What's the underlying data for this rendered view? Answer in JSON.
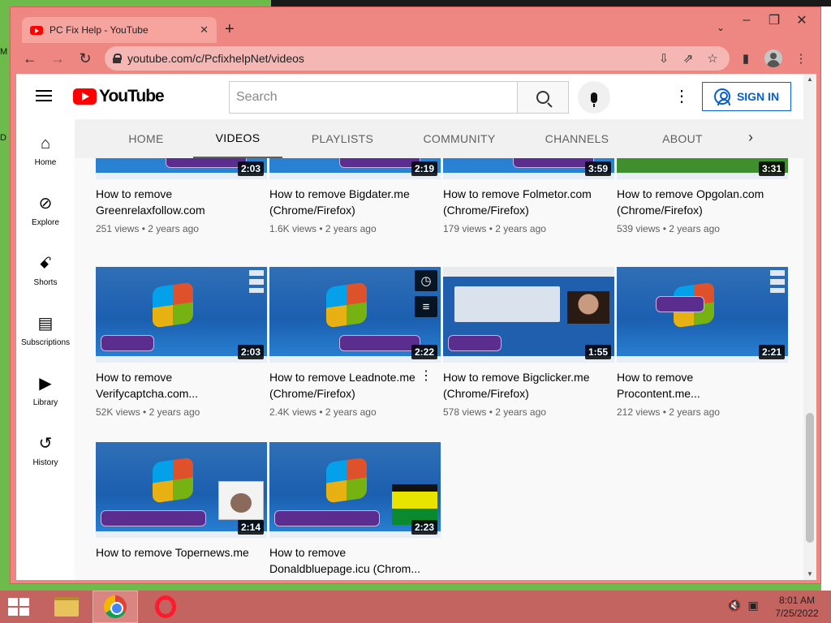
{
  "desktop": {
    "edge_letters": [
      "M",
      "D"
    ]
  },
  "browser": {
    "tab_title": "PC Fix Help - YouTube",
    "url": "youtube.com/c/PcfixhelpNet/videos",
    "window_controls": [
      "–",
      "❐",
      "✕"
    ]
  },
  "youtube": {
    "logo_text": "YouTube",
    "search_placeholder": "Search",
    "sign_in_label": "SIGN IN",
    "sidebar": [
      {
        "label": "Home",
        "icon": "home-icon",
        "glyph": "⌂"
      },
      {
        "label": "Explore",
        "icon": "compass-icon",
        "glyph": "⊘"
      },
      {
        "label": "Shorts",
        "icon": "shorts-icon",
        "glyph": "ꗃ"
      },
      {
        "label": "Subscriptions",
        "icon": "subscriptions-icon",
        "glyph": "▤"
      },
      {
        "label": "Library",
        "icon": "library-icon",
        "glyph": "▶"
      },
      {
        "label": "History",
        "icon": "history-icon",
        "glyph": "↺"
      }
    ],
    "channel_tabs": [
      "HOME",
      "VIDEOS",
      "PLAYLISTS",
      "COMMUNITY",
      "CHANNELS",
      "ABOUT"
    ],
    "active_tab": "VIDEOS",
    "videos": [
      {
        "title": "How to remove Greenrelaxfollow.com",
        "views": "251 views",
        "age": "2 years ago",
        "duration": "2:03"
      },
      {
        "title": "How to remove Bigdater.me (Chrome/Firefox)",
        "views": "1.6K views",
        "age": "2 years ago",
        "duration": "2:19"
      },
      {
        "title": "How to remove Folmetor.com (Chrome/Firefox)",
        "views": "179 views",
        "age": "2 years ago",
        "duration": "3:59"
      },
      {
        "title": "How to remove Opgolan.com (Chrome/Firefox)",
        "views": "539 views",
        "age": "2 years ago",
        "duration": "3:31"
      },
      {
        "title": "How to remove Verifycaptcha.com...",
        "views": "52K views",
        "age": "2 years ago",
        "duration": "2:03"
      },
      {
        "title": "How to remove Leadnote.me (Chrome/Firefox)",
        "views": "2.4K views",
        "age": "2 years ago",
        "duration": "2:22"
      },
      {
        "title": "How to remove Bigclicker.me (Chrome/Firefox)",
        "views": "578 views",
        "age": "2 years ago",
        "duration": "1:55"
      },
      {
        "title": "How to remove Procontent.me...",
        "views": "212 views",
        "age": "2 years ago",
        "duration": "2:21"
      },
      {
        "title": "How to remove Topernews.me",
        "views": "",
        "age": "",
        "duration": "2:14"
      },
      {
        "title": "How to remove Donaldbluepage.icu (Chrom...",
        "views": "",
        "age": "",
        "duration": "2:23"
      }
    ]
  },
  "taskbar": {
    "time": "8:01 AM",
    "date": "7/25/2022"
  }
}
